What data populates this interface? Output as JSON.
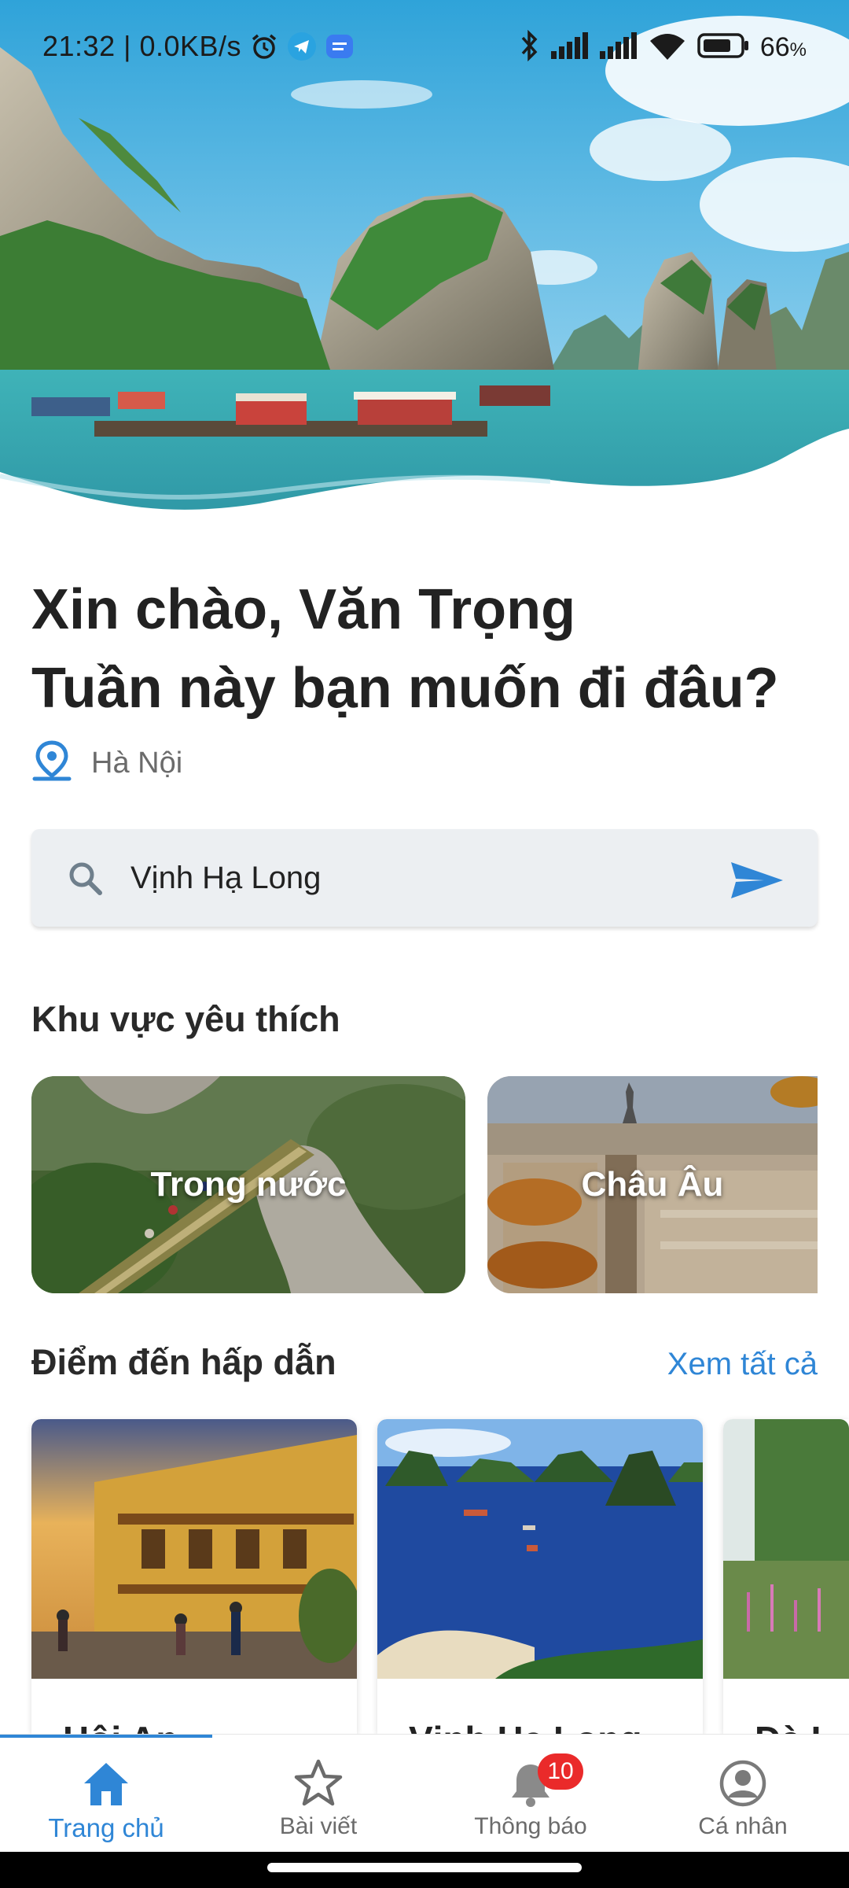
{
  "status_bar": {
    "time_speed": "21:32 | 0.0KB/s",
    "battery_percent": "66"
  },
  "greeting": {
    "line1": "Xin chào, Văn Trọng",
    "line2": "Tuần này bạn muốn đi đâu?"
  },
  "location": {
    "text": "Hà Nội"
  },
  "search": {
    "value": "Vịnh Hạ Long"
  },
  "favorite_regions": {
    "title": "Khu vực yêu thích",
    "items": [
      {
        "label": "Trong nước"
      },
      {
        "label": "Châu Âu"
      }
    ]
  },
  "destinations": {
    "title": "Điểm đến hấp dẫn",
    "see_all": "Xem tất cả",
    "items": [
      {
        "name": "Hội An"
      },
      {
        "name": "Vịnh Hạ Long"
      },
      {
        "name": "Đà L"
      }
    ]
  },
  "bottom_nav": {
    "items": [
      {
        "label": "Trang chủ",
        "icon": "home-icon",
        "active": true
      },
      {
        "label": "Bài viết",
        "icon": "star-icon"
      },
      {
        "label": "Thông báo",
        "icon": "bell-icon",
        "badge": "10"
      },
      {
        "label": "Cá nhân",
        "icon": "profile-icon"
      }
    ]
  },
  "colors": {
    "accent": "#2f86d6",
    "badge": "#ea2a2a",
    "search_bg": "#eceff2"
  }
}
